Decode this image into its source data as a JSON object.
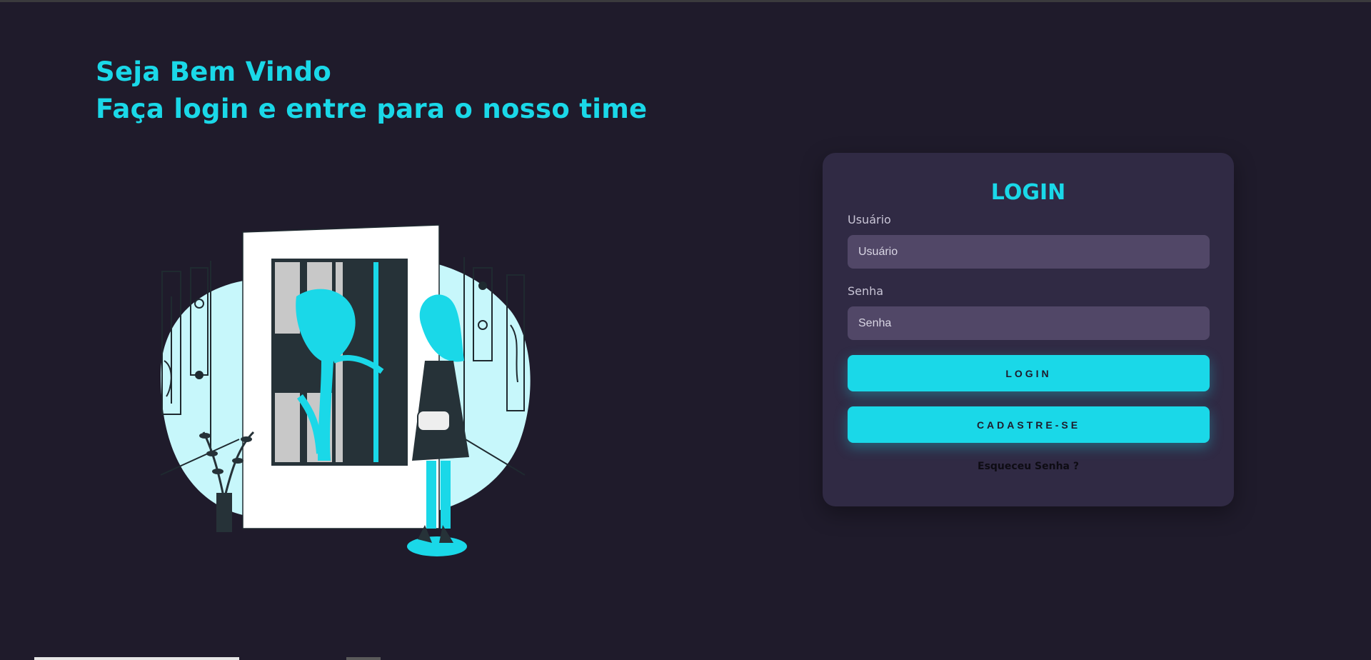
{
  "hero": {
    "line1": "Seja Bem Vindo",
    "line2": "Faça login e entre para o nosso time"
  },
  "login": {
    "title": "LOGIN",
    "username": {
      "label": "Usuário",
      "placeholder": "Usuário",
      "value": ""
    },
    "password": {
      "label": "Senha",
      "placeholder": "Senha",
      "value": ""
    },
    "login_button": "LOGIN",
    "signup_button": "CADASTRE-SE",
    "forgot_link": "Esqueceu Senha ?"
  },
  "theme": {
    "background": "#1f1b2b",
    "card": "#302a44",
    "accent": "#1ad8e8",
    "input": "#514767"
  },
  "illustration": {
    "icon": "art-gallery-illustration"
  }
}
